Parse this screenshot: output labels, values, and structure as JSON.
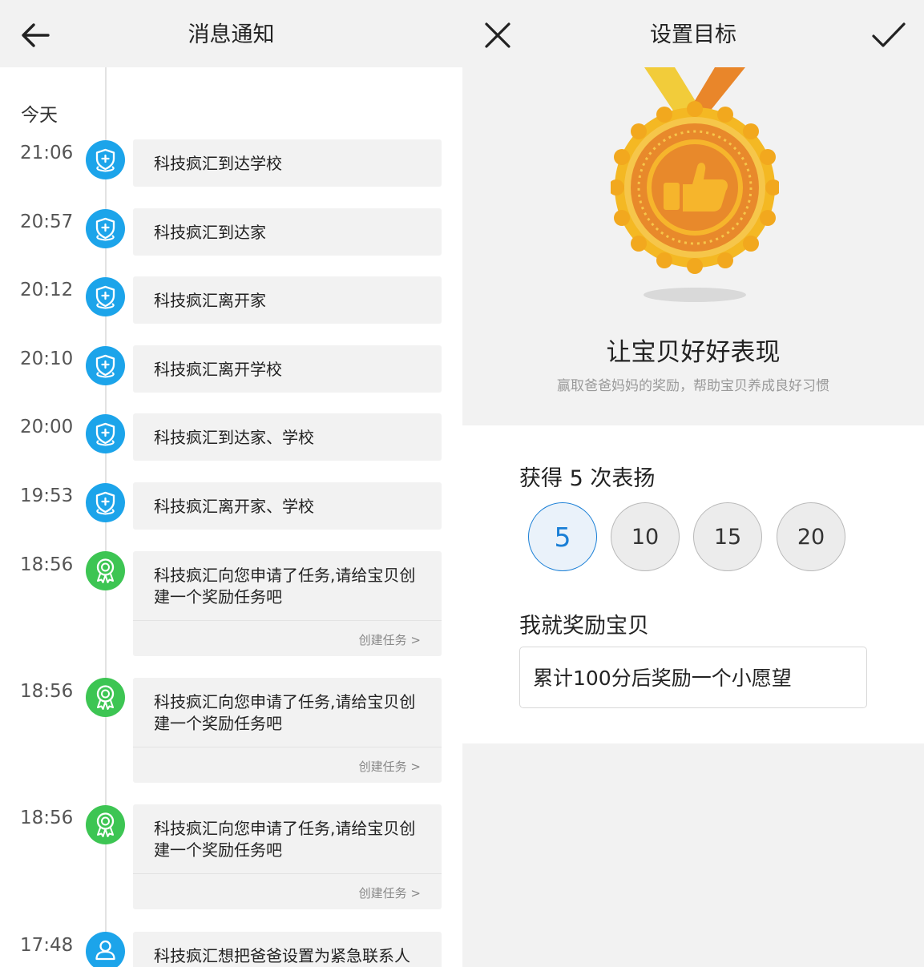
{
  "left": {
    "header": {
      "title": "消息通知"
    },
    "day_label": "今天",
    "items": [
      {
        "time": "21:06",
        "type": "location",
        "text": "科技疯汇到达学校"
      },
      {
        "time": "20:57",
        "type": "location",
        "text": "科技疯汇到达家"
      },
      {
        "time": "20:12",
        "type": "location",
        "text": "科技疯汇离开家"
      },
      {
        "time": "20:10",
        "type": "location",
        "text": "科技疯汇离开学校"
      },
      {
        "time": "20:00",
        "type": "location",
        "text": "科技疯汇到达家、学校"
      },
      {
        "time": "19:53",
        "type": "location",
        "text": "科技疯汇离开家、学校"
      },
      {
        "time": "18:56",
        "type": "task",
        "text": "科技疯汇向您申请了任务,请给宝贝创建一个奖励任务吧",
        "action": "创建任务 >"
      },
      {
        "time": "18:56",
        "type": "task",
        "text": "科技疯汇向您申请了任务,请给宝贝创建一个奖励任务吧",
        "action": "创建任务 >"
      },
      {
        "time": "18:56",
        "type": "task",
        "text": "科技疯汇向您申请了任务,请给宝贝创建一个奖励任务吧",
        "action": "创建任务 >"
      },
      {
        "time": "17:48",
        "type": "contact",
        "text": "科技疯汇想把爸爸设置为紧急联系人"
      }
    ]
  },
  "right": {
    "header": {
      "title": "设置目标"
    },
    "hero": {
      "title": "让宝贝好好表现",
      "subtitle": "赢取爸爸妈妈的奖励，帮助宝贝养成良好习惯"
    },
    "goal_label": "获得 5 次表扬",
    "options": [
      "5",
      "10",
      "15",
      "20"
    ],
    "selected": "5",
    "reward_label": "我就奖励宝贝",
    "reward_value": "累计100分后奖励一个小愿望"
  },
  "colors": {
    "blue": "#1ca4ea",
    "green": "#3dc553",
    "selected": "#1a7fd6",
    "medal": "#f5b325"
  }
}
